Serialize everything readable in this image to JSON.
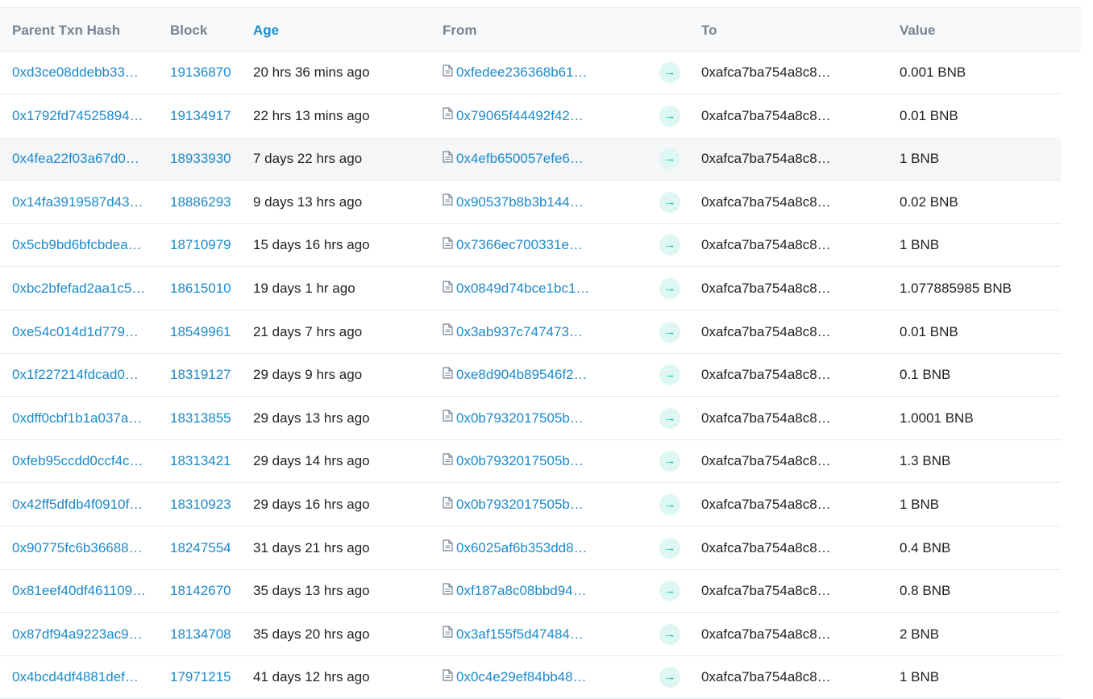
{
  "headers": {
    "parent_txn_hash": "Parent Txn Hash",
    "block": "Block",
    "age": "Age",
    "from": "From",
    "to": "To",
    "value": "Value"
  },
  "icons": {
    "contract": "document-icon",
    "direction": "arrow-right-icon"
  },
  "colors": {
    "link": "#1b8acb",
    "arrow": "#00c9a7",
    "arrow_bg": "#def7f2",
    "header_bg": "#f8f9fa"
  },
  "rows": [
    {
      "hash": "0xd3ce08ddebb33…",
      "block": "19136870",
      "age": "20 hrs 36 mins ago",
      "from": "0xfedee236368b61…",
      "arrow": "→",
      "to": "0xafca7ba754a8c8…",
      "value": "0.001 BNB"
    },
    {
      "hash": "0x1792fd74525894…",
      "block": "19134917",
      "age": "22 hrs 13 mins ago",
      "from": "0x79065f44492f42…",
      "arrow": "→",
      "to": "0xafca7ba754a8c8…",
      "value": "0.01 BNB"
    },
    {
      "hash": "0x4fea22f03a67d0…",
      "block": "18933930",
      "age": "7 days 22 hrs ago",
      "from": "0x4efb650057efe6…",
      "arrow": "→",
      "to": "0xafca7ba754a8c8…",
      "value": "1 BNB"
    },
    {
      "hash": "0x14fa3919587d43…",
      "block": "18886293",
      "age": "9 days 13 hrs ago",
      "from": "0x90537b8b3b144…",
      "arrow": "→",
      "to": "0xafca7ba754a8c8…",
      "value": "0.02 BNB"
    },
    {
      "hash": "0x5cb9bd6bfcbdea…",
      "block": "18710979",
      "age": "15 days 16 hrs ago",
      "from": "0x7366ec700331e…",
      "arrow": "→",
      "to": "0xafca7ba754a8c8…",
      "value": "1 BNB"
    },
    {
      "hash": "0xbc2bfefad2aa1c5…",
      "block": "18615010",
      "age": "19 days 1 hr ago",
      "from": "0x0849d74bce1bc1…",
      "arrow": "→",
      "to": "0xafca7ba754a8c8…",
      "value": "1.077885985 BNB"
    },
    {
      "hash": "0xe54c014d1d779…",
      "block": "18549961",
      "age": "21 days 7 hrs ago",
      "from": "0x3ab937c747473…",
      "arrow": "→",
      "to": "0xafca7ba754a8c8…",
      "value": "0.01 BNB"
    },
    {
      "hash": "0x1f227214fdcad0…",
      "block": "18319127",
      "age": "29 days 9 hrs ago",
      "from": "0xe8d904b89546f2…",
      "arrow": "→",
      "to": "0xafca7ba754a8c8…",
      "value": "0.1 BNB"
    },
    {
      "hash": "0xdff0cbf1b1a037a…",
      "block": "18313855",
      "age": "29 days 13 hrs ago",
      "from": "0x0b7932017505b…",
      "arrow": "→",
      "to": "0xafca7ba754a8c8…",
      "value": "1.0001 BNB"
    },
    {
      "hash": "0xfeb95ccdd0ccf4c…",
      "block": "18313421",
      "age": "29 days 14 hrs ago",
      "from": "0x0b7932017505b…",
      "arrow": "→",
      "to": "0xafca7ba754a8c8…",
      "value": "1.3 BNB"
    },
    {
      "hash": "0x42ff5dfdb4f0910f…",
      "block": "18310923",
      "age": "29 days 16 hrs ago",
      "from": "0x0b7932017505b…",
      "arrow": "→",
      "to": "0xafca7ba754a8c8…",
      "value": "1 BNB"
    },
    {
      "hash": "0x90775fc6b36688…",
      "block": "18247554",
      "age": "31 days 21 hrs ago",
      "from": "0x6025af6b353dd8…",
      "arrow": "→",
      "to": "0xafca7ba754a8c8…",
      "value": "0.4 BNB"
    },
    {
      "hash": "0x81eef40df461109…",
      "block": "18142670",
      "age": "35 days 13 hrs ago",
      "from": "0xf187a8c08bbd94…",
      "arrow": "→",
      "to": "0xafca7ba754a8c8…",
      "value": "0.8 BNB"
    },
    {
      "hash": "0x87df94a9223ac9…",
      "block": "18134708",
      "age": "35 days 20 hrs ago",
      "from": "0x3af155f5d47484…",
      "arrow": "→",
      "to": "0xafca7ba754a8c8…",
      "value": "2 BNB"
    },
    {
      "hash": "0x4bcd4df4881def…",
      "block": "17971215",
      "age": "41 days 12 hrs ago",
      "from": "0x0c4e29ef84bb48…",
      "arrow": "→",
      "to": "0xafca7ba754a8c8…",
      "value": "1 BNB"
    }
  ]
}
